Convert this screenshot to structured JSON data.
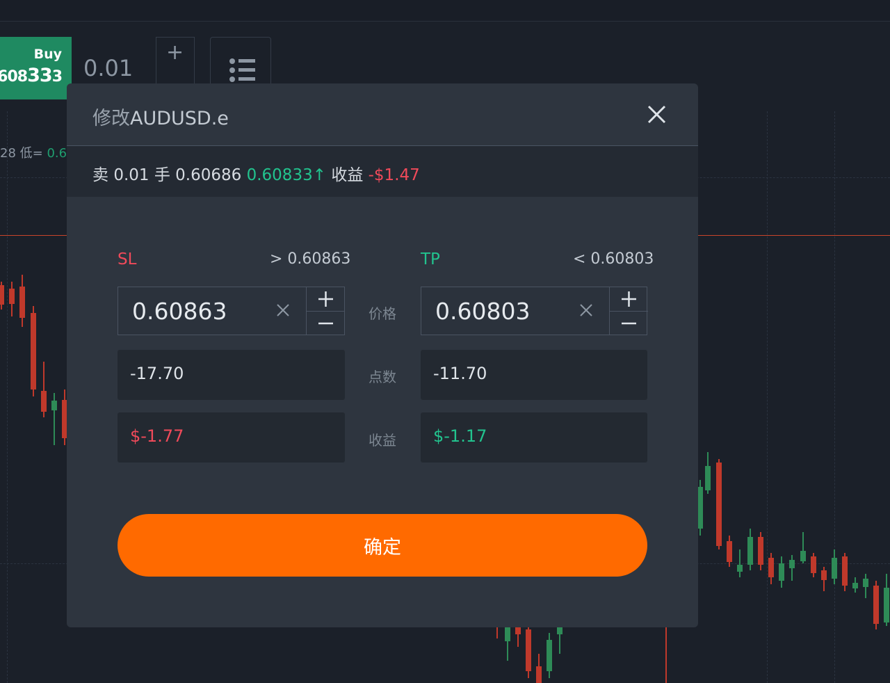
{
  "trade_bar": {
    "buy_label": "Buy",
    "buy_price_main": ".608",
    "buy_price_big": "33",
    "buy_price_small": "3",
    "lot": "0.01",
    "step_plus": "+",
    "low_label": "28 低=",
    "low_value": "0.6"
  },
  "modal": {
    "title_prefix": "修改",
    "title_symbol": "AUDUSD.e",
    "info": {
      "side": "卖",
      "lots": "0.01",
      "lot_unit": "手",
      "open_price": "0.60686",
      "current_price": "0.60833",
      "trend_arrow": "↑",
      "profit_label": "收益",
      "profit_value": "-$1.47"
    },
    "sl": {
      "label": "SL",
      "limit": "> 0.60863",
      "price": "0.60863",
      "points": "-17.70",
      "profit": "$-1.77"
    },
    "tp": {
      "label": "TP",
      "limit": "< 0.60803",
      "price": "0.60803",
      "points": "-11.70",
      "profit": "$-1.17"
    },
    "row_labels": {
      "price": "价格",
      "points": "点数",
      "profit": "收益"
    },
    "confirm_label": "确定"
  },
  "colors": {
    "sl": "#f04a5a",
    "tp": "#22c38e",
    "confirm": "#ff6a00",
    "buy": "#1f8a61"
  }
}
